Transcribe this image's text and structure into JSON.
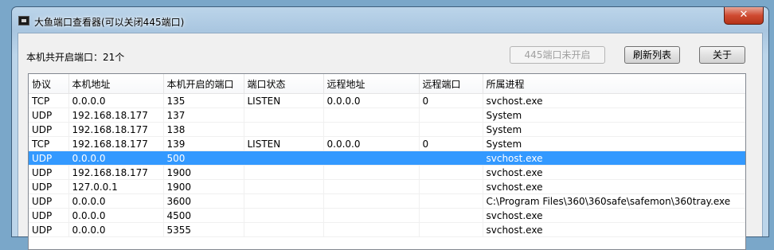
{
  "window": {
    "title": "大鱼端口查看器(可以关闭445端口)",
    "close_label": "✕"
  },
  "summary": {
    "open_ports_label": "本机共开启端口：21个"
  },
  "buttons": {
    "port445": "445端口未开启",
    "refresh": "刷新列表",
    "about": "关于"
  },
  "table": {
    "columns": [
      "协议",
      "本机地址",
      "本机开启的端口",
      "端口状态",
      "远程地址",
      "远程端口",
      "所属进程"
    ],
    "rows": [
      [
        "TCP",
        "0.0.0.0",
        "135",
        "LISTEN",
        "0.0.0.0",
        "0",
        "svchost.exe"
      ],
      [
        "UDP",
        "192.168.18.177",
        "137",
        "",
        "",
        "",
        "System"
      ],
      [
        "UDP",
        "192.168.18.177",
        "138",
        "",
        "",
        "",
        "System"
      ],
      [
        "TCP",
        "192.168.18.177",
        "139",
        "LISTEN",
        "0.0.0.0",
        "0",
        "System"
      ],
      [
        "UDP",
        "0.0.0.0",
        "500",
        "",
        "",
        "",
        "svchost.exe"
      ],
      [
        "UDP",
        "192.168.18.177",
        "1900",
        "",
        "",
        "",
        "svchost.exe"
      ],
      [
        "UDP",
        "127.0.0.1",
        "1900",
        "",
        "",
        "",
        "svchost.exe"
      ],
      [
        "UDP",
        "0.0.0.0",
        "3600",
        "",
        "",
        "",
        "C:\\Program Files\\360\\360safe\\safemon\\360tray.exe"
      ],
      [
        "UDP",
        "0.0.0.0",
        "4500",
        "",
        "",
        "",
        "svchost.exe"
      ],
      [
        "UDP",
        "0.0.0.0",
        "5355",
        "",
        "",
        "",
        "svchost.exe"
      ]
    ],
    "selected_row": 4
  }
}
